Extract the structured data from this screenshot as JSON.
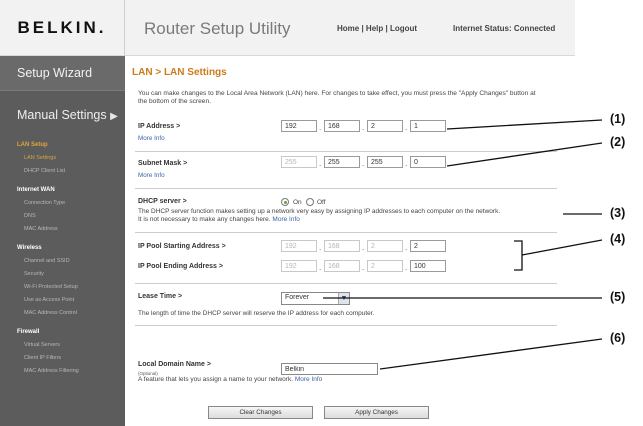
{
  "header": {
    "logo": "BELKIN.",
    "title": "Router Setup Utility",
    "links": [
      "Home",
      "Help",
      "Logout"
    ],
    "status": "Internet Status: Connected"
  },
  "sidebar": {
    "setup_wizard": "Setup Wizard",
    "manual_settings": "Manual Settings",
    "groups": [
      {
        "title": "LAN Setup",
        "items": [
          "LAN Settings",
          "DHCP Client List"
        ]
      },
      {
        "title": "Internet WAN",
        "items": [
          "Connection Type",
          "DNS",
          "MAC Address"
        ]
      },
      {
        "title": "Wireless",
        "items": [
          "Channel and SSID",
          "Security",
          "Wi-Fi Protected Setup",
          "Use as Access Point",
          "MAC Address Control"
        ]
      },
      {
        "title": "Firewall",
        "items": [
          "Virtual Servers",
          "Client IP Filters",
          "MAC Address Filtering"
        ]
      }
    ],
    "active_item": "LAN Settings",
    "accent_color": "#d9a441"
  },
  "main": {
    "heading": "LAN > LAN Settings",
    "intro": "You can make changes to the Local Area Network (LAN) here. For changes to take effect, you must press the \"Apply Changes\" button at the bottom of the screen.",
    "ip_address": {
      "label": "IP Address >",
      "more_info": "More Info",
      "octets": [
        "192",
        "168",
        "2",
        "1"
      ]
    },
    "subnet_mask": {
      "label": "Subnet Mask >",
      "more_info": "More Info",
      "octets": [
        "255",
        "255",
        "255",
        "0"
      ]
    },
    "dhcp": {
      "label": "DHCP server >",
      "on_label": "On",
      "off_label": "Off",
      "selected": "On",
      "description": "The DHCP server function makes setting up a network very easy by assigning IP addresses to each computer on the network. It is not necessary to make any changes here.",
      "more_info": "More Info"
    },
    "pool_start": {
      "label": "IP Pool Starting Address >",
      "octets": [
        "192",
        "168",
        "2",
        "2"
      ]
    },
    "pool_end": {
      "label": "IP Pool Ending Address >",
      "octets": [
        "192",
        "168",
        "2",
        "100"
      ]
    },
    "lease": {
      "label": "Lease Time >",
      "value": "Forever",
      "description": "The length of time the DHCP server will reserve the IP address for each computer."
    },
    "domain": {
      "label": "Local Domain Name >",
      "optional": "(Optional)",
      "value": "Belkin",
      "description": "A feature that lets you assign a name to your network.",
      "more_info": "More Info"
    },
    "buttons": {
      "clear": "Clear Changes",
      "apply": "Apply Changes"
    }
  },
  "callouts": [
    "(1)",
    "(2)",
    "(3)",
    "(4)",
    "(5)",
    "(6)"
  ]
}
